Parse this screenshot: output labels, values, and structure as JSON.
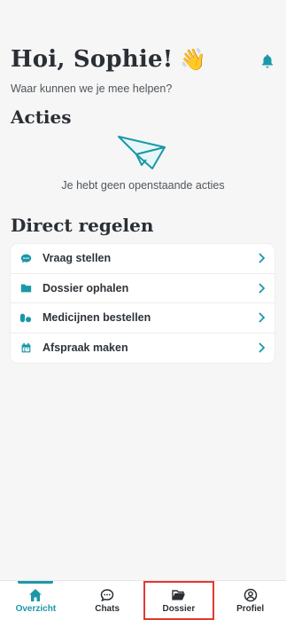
{
  "greeting": {
    "title": "Hoi, Sophie!",
    "emoji": "👋",
    "subtitle": "Waar kunnen we je mee helpen?"
  },
  "actions": {
    "title": "Acties",
    "empty_text": "Je hebt geen openstaande acties"
  },
  "direct": {
    "title": "Direct regelen",
    "items": [
      {
        "label": "Vraag stellen",
        "icon": "chat-bubble-icon"
      },
      {
        "label": "Dossier ophalen",
        "icon": "folder-icon"
      },
      {
        "label": "Medicijnen bestellen",
        "icon": "pills-icon"
      },
      {
        "label": "Afspraak maken",
        "icon": "calendar-icon"
      }
    ]
  },
  "tabbar": {
    "tabs": [
      {
        "label": "Overzicht",
        "icon": "home-icon",
        "active": true
      },
      {
        "label": "Chats",
        "icon": "chat-icon"
      },
      {
        "label": "Dossier",
        "icon": "folder-open-icon"
      },
      {
        "label": "Profiel",
        "icon": "user-icon"
      }
    ]
  },
  "colors": {
    "accent": "#1b98a8",
    "highlight": "#e2392f"
  }
}
